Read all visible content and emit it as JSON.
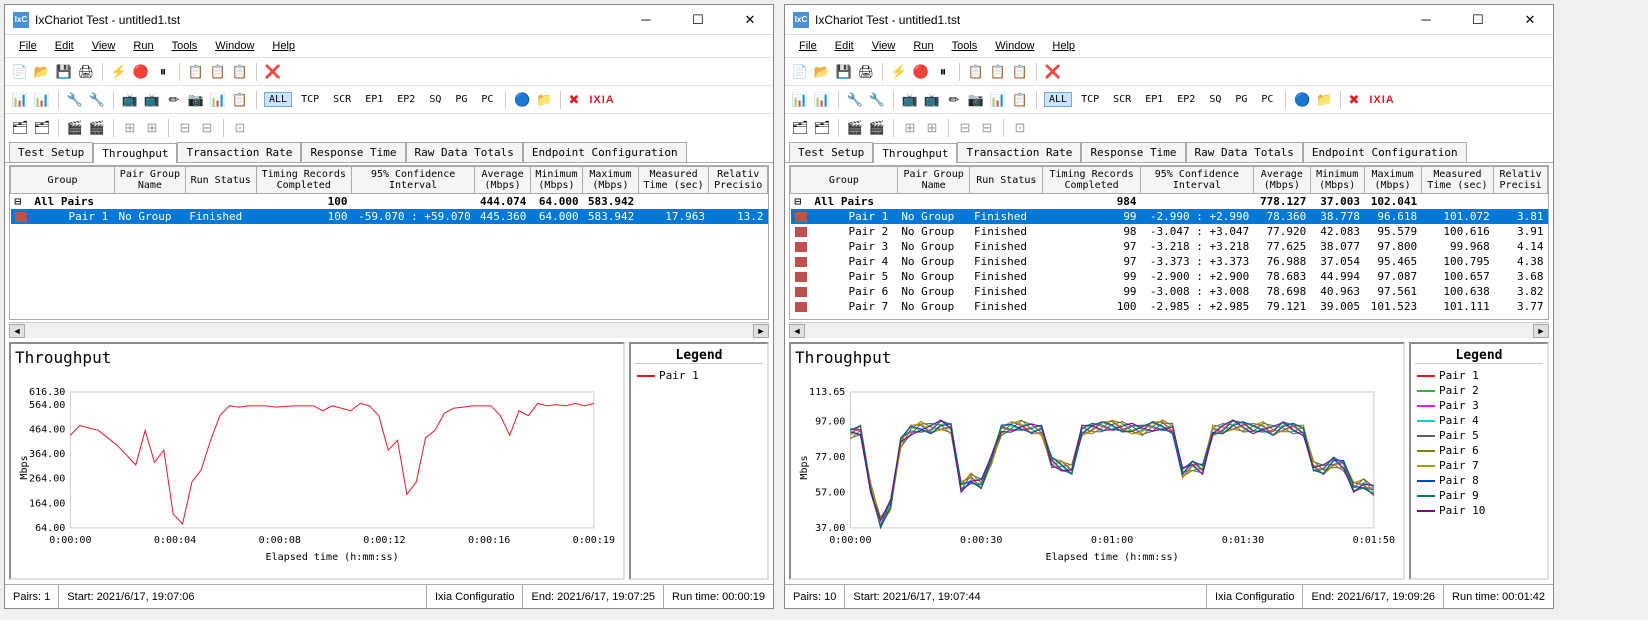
{
  "windows": [
    {
      "title": "IxChariot Test - untitled1.tst",
      "menus": [
        "File",
        "Edit",
        "View",
        "Run",
        "Tools",
        "Window",
        "Help"
      ],
      "tabs": [
        "Test Setup",
        "Throughput",
        "Transaction Rate",
        "Response Time",
        "Raw Data Totals",
        "Endpoint Configuration"
      ],
      "active_tab": "Throughput",
      "columns": [
        "Group",
        "Pair Group\nName",
        "Run Status",
        "Timing Records\nCompleted",
        "95% Confidence\nInterval",
        "Average\n(Mbps)",
        "Minimum\n(Mbps)",
        "Maximum\n(Mbps)",
        "Measured\nTime (sec)",
        "Relativ\nPrecisio"
      ],
      "group_row": {
        "label": "All Pairs",
        "completed": "100",
        "avg": "444.074",
        "min": "64.000",
        "max": "583.942"
      },
      "rows": [
        {
          "pair": "Pair 1",
          "pg": "No Group",
          "status": "Finished",
          "tr": "100",
          "ci": "-59.070 : +59.070",
          "avg": "445.360",
          "min": "64.000",
          "max": "583.942",
          "time": "17.963",
          "prec": "13.2",
          "selected": true
        }
      ],
      "chart_title": "Throughput",
      "legend_title": "Legend",
      "legend": [
        {
          "name": "Pair 1",
          "color": "#e31b23"
        }
      ],
      "ylabel": "Mbps",
      "xlabel": "Elapsed time (h:mm:ss)",
      "status": {
        "pairs": "Pairs: 1",
        "start": "Start: 2021/6/17, 19:07:06",
        "cfg": "Ixia Configuratio",
        "end": "End: 2021/6/17, 19:07:25",
        "run": "Run time: 00:00:19"
      }
    },
    {
      "title": "IxChariot Test - untitled1.tst",
      "menus": [
        "File",
        "Edit",
        "View",
        "Run",
        "Tools",
        "Window",
        "Help"
      ],
      "tabs": [
        "Test Setup",
        "Throughput",
        "Transaction Rate",
        "Response Time",
        "Raw Data Totals",
        "Endpoint Configuration"
      ],
      "active_tab": "Throughput",
      "columns": [
        "Group",
        "Pair Group\nName",
        "Run Status",
        "Timing Records\nCompleted",
        "95% Confidence\nInterval",
        "Average\n(Mbps)",
        "Minimum\n(Mbps)",
        "Maximum\n(Mbps)",
        "Measured\nTime (sec)",
        "Relativ\nPrecisi"
      ],
      "group_row": {
        "label": "All Pairs",
        "completed": "984",
        "avg": "778.127",
        "min": "37.003",
        "max": "102.041"
      },
      "rows": [
        {
          "pair": "Pair 1",
          "pg": "No Group",
          "status": "Finished",
          "tr": "99",
          "ci": "-2.990 : +2.990",
          "avg": "78.360",
          "min": "38.778",
          "max": "96.618",
          "time": "101.072",
          "prec": "3.81",
          "selected": true
        },
        {
          "pair": "Pair 2",
          "pg": "No Group",
          "status": "Finished",
          "tr": "98",
          "ci": "-3.047 : +3.047",
          "avg": "77.920",
          "min": "42.083",
          "max": "95.579",
          "time": "100.616",
          "prec": "3.91"
        },
        {
          "pair": "Pair 3",
          "pg": "No Group",
          "status": "Finished",
          "tr": "97",
          "ci": "-3.218 : +3.218",
          "avg": "77.625",
          "min": "38.077",
          "max": "97.800",
          "time": "99.968",
          "prec": "4.14"
        },
        {
          "pair": "Pair 4",
          "pg": "No Group",
          "status": "Finished",
          "tr": "97",
          "ci": "-3.373 : +3.373",
          "avg": "76.988",
          "min": "37.054",
          "max": "95.465",
          "time": "100.795",
          "prec": "4.38"
        },
        {
          "pair": "Pair 5",
          "pg": "No Group",
          "status": "Finished",
          "tr": "99",
          "ci": "-2.900 : +2.900",
          "avg": "78.683",
          "min": "44.994",
          "max": "97.087",
          "time": "100.657",
          "prec": "3.68"
        },
        {
          "pair": "Pair 6",
          "pg": "No Group",
          "status": "Finished",
          "tr": "99",
          "ci": "-3.008 : +3.008",
          "avg": "78.698",
          "min": "40.963",
          "max": "97.561",
          "time": "100.638",
          "prec": "3.82"
        },
        {
          "pair": "Pair 7",
          "pg": "No Group",
          "status": "Finished",
          "tr": "100",
          "ci": "-2.985 : +2.985",
          "avg": "79.121",
          "min": "39.005",
          "max": "101.523",
          "time": "101.111",
          "prec": "3.77"
        }
      ],
      "chart_title": "Throughput",
      "legend_title": "Legend",
      "legend": [
        {
          "name": "Pair 1",
          "color": "#e31b23"
        },
        {
          "name": "Pair 2",
          "color": "#2eb82e"
        },
        {
          "name": "Pair 3",
          "color": "#e020e0"
        },
        {
          "name": "Pair 4",
          "color": "#00d0d0"
        },
        {
          "name": "Pair 5",
          "color": "#606060"
        },
        {
          "name": "Pair 6",
          "color": "#808000"
        },
        {
          "name": "Pair 7",
          "color": "#a0a000"
        },
        {
          "name": "Pair 8",
          "color": "#0040d0"
        },
        {
          "name": "Pair 9",
          "color": "#008060"
        },
        {
          "name": "Pair 10",
          "color": "#800080"
        }
      ],
      "ylabel": "Mbps",
      "xlabel": "Elapsed time (h:mm:ss)",
      "status": {
        "pairs": "Pairs: 10",
        "start": "Start: 2021/6/17, 19:07:44",
        "cfg": "Ixia Configuratio",
        "end": "End: 2021/6/17, 19:09:26",
        "run": "Run time: 00:01:42"
      }
    }
  ],
  "filter_buttons": [
    "ALL",
    "TCP",
    "SCR",
    "EP1",
    "EP2",
    "SQ",
    "PG",
    "PC"
  ],
  "chart_data": [
    {
      "type": "line",
      "title": "Throughput",
      "xlabel": "Elapsed time (h:mm:ss)",
      "ylabel": "Mbps",
      "x_ticks": [
        "0:00:00",
        "0:00:04",
        "0:00:08",
        "0:00:12",
        "0:00:16",
        "0:00:19"
      ],
      "y_ticks": [
        64.0,
        164.0,
        264.0,
        364.0,
        464.0,
        564.0,
        616.3
      ],
      "ylim": [
        64,
        616.3
      ],
      "series": [
        {
          "name": "Pair 1",
          "color": "#e31b23",
          "values": [
            440,
            480,
            470,
            460,
            430,
            400,
            360,
            320,
            460,
            330,
            380,
            120,
            80,
            250,
            300,
            420,
            520,
            560,
            555,
            560,
            560,
            560,
            555,
            558,
            560,
            560,
            560,
            540,
            560,
            550,
            540,
            570,
            560,
            520,
            380,
            420,
            200,
            250,
            430,
            460,
            530,
            550,
            555,
            560,
            560,
            560,
            520,
            440,
            540,
            520,
            570,
            560,
            565,
            560,
            570,
            560,
            570
          ]
        }
      ]
    },
    {
      "type": "line",
      "title": "Throughput",
      "xlabel": "Elapsed time (h:mm:ss)",
      "ylabel": "Mbps",
      "x_ticks": [
        "0:00:00",
        "0:00:30",
        "0:01:00",
        "0:01:30",
        "0:01:50"
      ],
      "y_ticks": [
        37.0,
        57.0,
        77.0,
        97.0,
        113.65
      ],
      "ylim": [
        37,
        113.65
      ],
      "series": [
        {
          "name": "Pair 1",
          "color": "#e31b23"
        },
        {
          "name": "Pair 2",
          "color": "#2eb82e"
        },
        {
          "name": "Pair 3",
          "color": "#e020e0"
        },
        {
          "name": "Pair 4",
          "color": "#00d0d0"
        },
        {
          "name": "Pair 5",
          "color": "#606060"
        },
        {
          "name": "Pair 6",
          "color": "#808000"
        },
        {
          "name": "Pair 7",
          "color": "#a0a000"
        },
        {
          "name": "Pair 8",
          "color": "#0040d0"
        },
        {
          "name": "Pair 9",
          "color": "#008060"
        },
        {
          "name": "Pair 10",
          "color": "#800080"
        }
      ],
      "envelope": [
        90,
        92,
        60,
        40,
        50,
        85,
        92,
        94,
        93,
        95,
        93,
        60,
        65,
        62,
        75,
        92,
        94,
        95,
        93,
        92,
        74,
        72,
        70,
        92,
        93,
        94,
        95,
        94,
        93,
        92,
        94,
        95,
        93,
        68,
        72,
        70,
        92,
        93,
        95,
        94,
        93,
        94,
        92,
        94,
        93,
        92,
        72,
        70,
        74,
        72,
        60,
        62,
        58
      ]
    }
  ]
}
